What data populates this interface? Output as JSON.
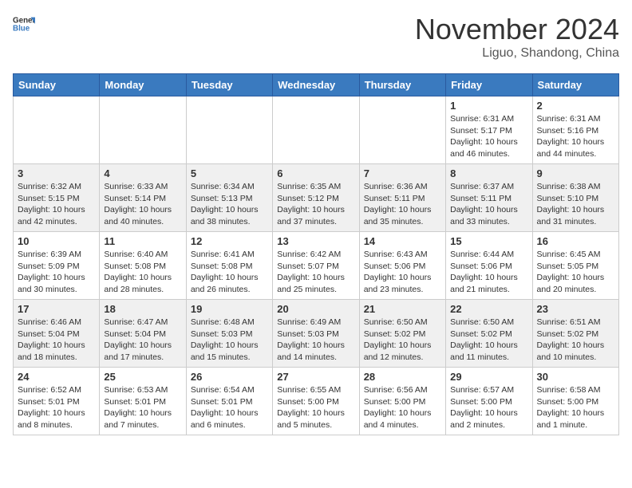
{
  "header": {
    "logo": {
      "text_general": "General",
      "text_blue": "Blue",
      "icon_alt": "GeneralBlue logo"
    },
    "month": "November 2024",
    "location": "Liguo, Shandong, China"
  },
  "days_of_week": [
    "Sunday",
    "Monday",
    "Tuesday",
    "Wednesday",
    "Thursday",
    "Friday",
    "Saturday"
  ],
  "weeks": [
    {
      "days": [
        {
          "date": "",
          "info": ""
        },
        {
          "date": "",
          "info": ""
        },
        {
          "date": "",
          "info": ""
        },
        {
          "date": "",
          "info": ""
        },
        {
          "date": "",
          "info": ""
        },
        {
          "date": "1",
          "info": "Sunrise: 6:31 AM\nSunset: 5:17 PM\nDaylight: 10 hours\nand 46 minutes."
        },
        {
          "date": "2",
          "info": "Sunrise: 6:31 AM\nSunset: 5:16 PM\nDaylight: 10 hours\nand 44 minutes."
        }
      ]
    },
    {
      "days": [
        {
          "date": "3",
          "info": "Sunrise: 6:32 AM\nSunset: 5:15 PM\nDaylight: 10 hours\nand 42 minutes."
        },
        {
          "date": "4",
          "info": "Sunrise: 6:33 AM\nSunset: 5:14 PM\nDaylight: 10 hours\nand 40 minutes."
        },
        {
          "date": "5",
          "info": "Sunrise: 6:34 AM\nSunset: 5:13 PM\nDaylight: 10 hours\nand 38 minutes."
        },
        {
          "date": "6",
          "info": "Sunrise: 6:35 AM\nSunset: 5:12 PM\nDaylight: 10 hours\nand 37 minutes."
        },
        {
          "date": "7",
          "info": "Sunrise: 6:36 AM\nSunset: 5:11 PM\nDaylight: 10 hours\nand 35 minutes."
        },
        {
          "date": "8",
          "info": "Sunrise: 6:37 AM\nSunset: 5:11 PM\nDaylight: 10 hours\nand 33 minutes."
        },
        {
          "date": "9",
          "info": "Sunrise: 6:38 AM\nSunset: 5:10 PM\nDaylight: 10 hours\nand 31 minutes."
        }
      ]
    },
    {
      "days": [
        {
          "date": "10",
          "info": "Sunrise: 6:39 AM\nSunset: 5:09 PM\nDaylight: 10 hours\nand 30 minutes."
        },
        {
          "date": "11",
          "info": "Sunrise: 6:40 AM\nSunset: 5:08 PM\nDaylight: 10 hours\nand 28 minutes."
        },
        {
          "date": "12",
          "info": "Sunrise: 6:41 AM\nSunset: 5:08 PM\nDaylight: 10 hours\nand 26 minutes."
        },
        {
          "date": "13",
          "info": "Sunrise: 6:42 AM\nSunset: 5:07 PM\nDaylight: 10 hours\nand 25 minutes."
        },
        {
          "date": "14",
          "info": "Sunrise: 6:43 AM\nSunset: 5:06 PM\nDaylight: 10 hours\nand 23 minutes."
        },
        {
          "date": "15",
          "info": "Sunrise: 6:44 AM\nSunset: 5:06 PM\nDaylight: 10 hours\nand 21 minutes."
        },
        {
          "date": "16",
          "info": "Sunrise: 6:45 AM\nSunset: 5:05 PM\nDaylight: 10 hours\nand 20 minutes."
        }
      ]
    },
    {
      "days": [
        {
          "date": "17",
          "info": "Sunrise: 6:46 AM\nSunset: 5:04 PM\nDaylight: 10 hours\nand 18 minutes."
        },
        {
          "date": "18",
          "info": "Sunrise: 6:47 AM\nSunset: 5:04 PM\nDaylight: 10 hours\nand 17 minutes."
        },
        {
          "date": "19",
          "info": "Sunrise: 6:48 AM\nSunset: 5:03 PM\nDaylight: 10 hours\nand 15 minutes."
        },
        {
          "date": "20",
          "info": "Sunrise: 6:49 AM\nSunset: 5:03 PM\nDaylight: 10 hours\nand 14 minutes."
        },
        {
          "date": "21",
          "info": "Sunrise: 6:50 AM\nSunset: 5:02 PM\nDaylight: 10 hours\nand 12 minutes."
        },
        {
          "date": "22",
          "info": "Sunrise: 6:50 AM\nSunset: 5:02 PM\nDaylight: 10 hours\nand 11 minutes."
        },
        {
          "date": "23",
          "info": "Sunrise: 6:51 AM\nSunset: 5:02 PM\nDaylight: 10 hours\nand 10 minutes."
        }
      ]
    },
    {
      "days": [
        {
          "date": "24",
          "info": "Sunrise: 6:52 AM\nSunset: 5:01 PM\nDaylight: 10 hours\nand 8 minutes."
        },
        {
          "date": "25",
          "info": "Sunrise: 6:53 AM\nSunset: 5:01 PM\nDaylight: 10 hours\nand 7 minutes."
        },
        {
          "date": "26",
          "info": "Sunrise: 6:54 AM\nSunset: 5:01 PM\nDaylight: 10 hours\nand 6 minutes."
        },
        {
          "date": "27",
          "info": "Sunrise: 6:55 AM\nSunset: 5:00 PM\nDaylight: 10 hours\nand 5 minutes."
        },
        {
          "date": "28",
          "info": "Sunrise: 6:56 AM\nSunset: 5:00 PM\nDaylight: 10 hours\nand 4 minutes."
        },
        {
          "date": "29",
          "info": "Sunrise: 6:57 AM\nSunset: 5:00 PM\nDaylight: 10 hours\nand 2 minutes."
        },
        {
          "date": "30",
          "info": "Sunrise: 6:58 AM\nSunset: 5:00 PM\nDaylight: 10 hours\nand 1 minute."
        }
      ]
    }
  ],
  "colors": {
    "header_bg": "#3a7abf",
    "logo_blue": "#3a7abf"
  }
}
